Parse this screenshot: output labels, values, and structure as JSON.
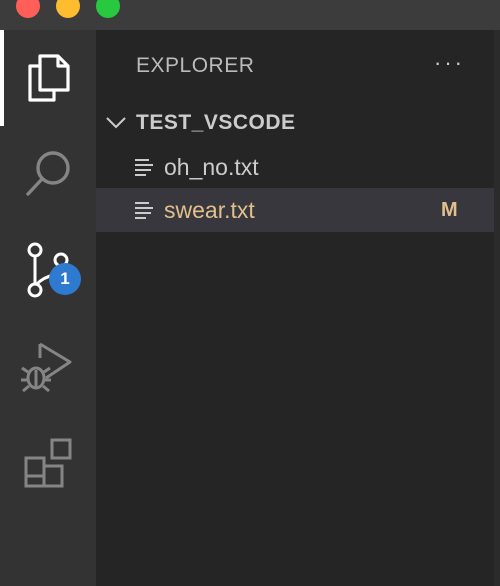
{
  "window": {
    "controls": [
      "close",
      "minimize",
      "maximize"
    ]
  },
  "activity_bar": {
    "items": [
      {
        "icon": "files-icon",
        "active": true
      },
      {
        "icon": "search-icon",
        "active": false
      },
      {
        "icon": "source-control-icon",
        "active": false,
        "badge": "1"
      },
      {
        "icon": "run-debug-icon",
        "active": false
      },
      {
        "icon": "extensions-icon",
        "active": false
      }
    ]
  },
  "explorer": {
    "title": "EXPLORER",
    "more_actions": "···",
    "folder": {
      "name": "TEST_VSCODE",
      "expanded": true
    },
    "files": [
      {
        "name": "oh_no.txt",
        "status": "",
        "selected": false,
        "color": "#cccccc"
      },
      {
        "name": "swear.txt",
        "status": "M",
        "selected": true,
        "color": "#e2c08d"
      }
    ]
  },
  "colors": {
    "activity_bar_bg": "#333333",
    "sidebar_bg": "#252526",
    "selected_row_bg": "#37373d",
    "badge_bg": "#2e7ad1",
    "modified_text": "#e2c08d"
  }
}
